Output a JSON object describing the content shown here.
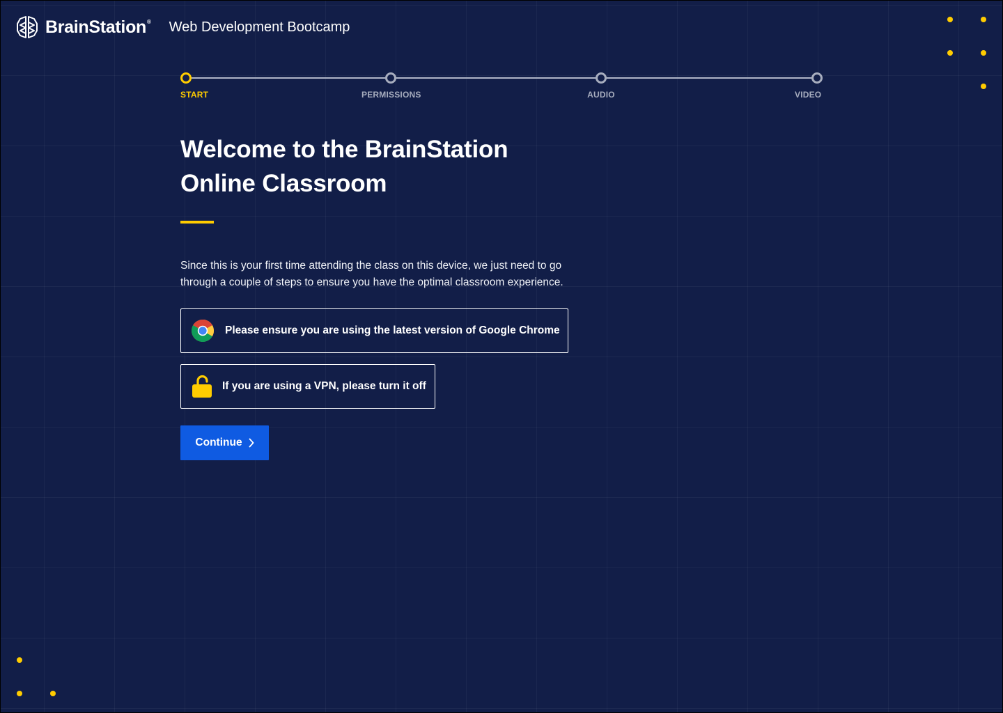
{
  "header": {
    "brand": "BrainStation",
    "brand_mark": "®",
    "program_title": "Web Development Bootcamp"
  },
  "stepper": {
    "steps": [
      {
        "label": "START",
        "active": true
      },
      {
        "label": "PERMISSIONS",
        "active": false
      },
      {
        "label": "AUDIO",
        "active": false
      },
      {
        "label": "VIDEO",
        "active": false
      }
    ]
  },
  "main": {
    "heading_line1": "Welcome to the BrainStation",
    "heading_line2": "Online Classroom",
    "intro": "Since this is your first time attending the class on this device, we just need to go through a couple of steps to ensure you have the optimal classroom experience.",
    "notices": [
      {
        "icon": "chrome-icon",
        "text": "Please ensure you are using the latest version of Google Chrome"
      },
      {
        "icon": "unlocked-padlock-icon",
        "text": "If you are using a VPN, please turn it off"
      }
    ],
    "continue_label": "Continue"
  },
  "colors": {
    "background": "#121e48",
    "accent": "#ffcc00",
    "primary_button": "#0f5be2",
    "inactive_step": "#a7adbe"
  }
}
